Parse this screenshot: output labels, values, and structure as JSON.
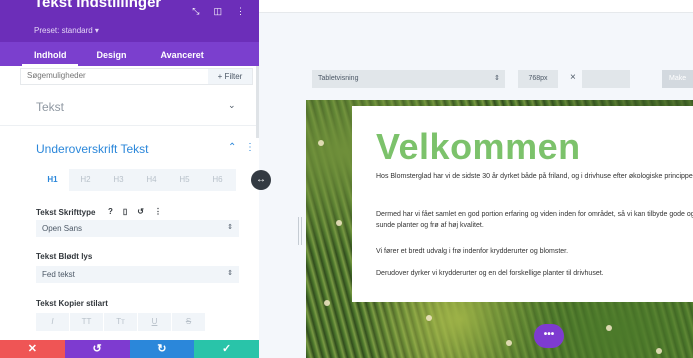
{
  "panel": {
    "title": "Tekst Indstillinger",
    "preset": "Preset: standard ▾",
    "tabs": [
      "Indhold",
      "Design",
      "Avanceret"
    ],
    "search_placeholder": "Søgemuligheder",
    "filter_label": "+ Filter",
    "toggle_tekst_label": "Tekst",
    "section_title": "Underoverskrift Tekst",
    "heading_tabs": [
      "H1",
      "H2",
      "H3",
      "H4",
      "H5",
      "H6"
    ],
    "font_label": "Tekst Skrifttype",
    "font_value": "Open Sans",
    "weight_label": "Tekst Blødt lys",
    "weight_value": "Fed tekst",
    "style_label": "Tekst Kopier stilart",
    "style_buttons": [
      "I",
      "TT",
      "Tт",
      "U",
      "S"
    ]
  },
  "canvas": {
    "view_mode": "Tabletvisning",
    "width_value": "768px",
    "clear_label": "×",
    "make_label": "Make"
  },
  "preview": {
    "heading": "Velkommen",
    "paragraphs": [
      "Hos Blomsterglad har vi de sidste 30 år dyrket både på friland, og i drivhuse efter økologiske principper.",
      "Dermed har vi fået samlet en god portion erfaring og viden inden for området, så vi kan tilbyde gode og sunde planter og frø af høj kvalitet.",
      "Vi fører et bredt udvalg i frø indenfor krydderurter og blomster.",
      "Derudover dyrker vi krydderurter og en del forskellige planter til drivhuset."
    ]
  },
  "colors": {
    "panel_header": "#6c2eb9",
    "tabs_bar": "#7b3fce",
    "accent_blue": "#2b87da",
    "heading_green": "#7cc26b",
    "cancel_red": "#ef5555",
    "undo_purple": "#7e3bd0",
    "redo_blue": "#2b87da",
    "save_teal": "#29c4a9"
  }
}
